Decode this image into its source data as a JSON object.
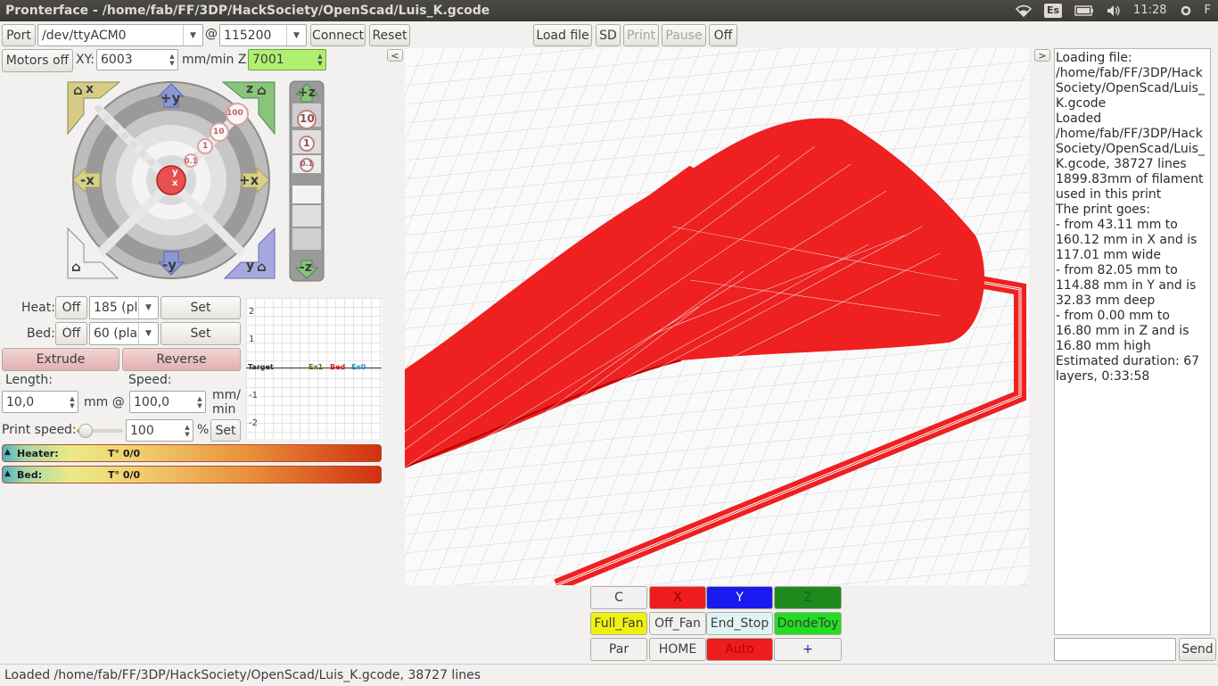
{
  "window": {
    "title": "Pronterface - /home/fab/FF/3DP/HackSociety/OpenScad/Luis_K.gcode"
  },
  "tray": {
    "keyboard": "Es",
    "time": "11:28",
    "user": "F",
    "icons": [
      "wifi-icon",
      "battery-icon",
      "volume-icon"
    ]
  },
  "toolbar": {
    "port_label": "Port",
    "port_value": "/dev/ttyACM0",
    "at": "@",
    "baud_value": "115200",
    "connect_label": "Connect",
    "reset_label": "Reset",
    "load_label": "Load file",
    "sd_label": "SD",
    "print_label": "Print",
    "pause_label": "Pause",
    "off_label": "Off"
  },
  "motors": {
    "motors_off_label": "Motors off",
    "xy_label": "XY:",
    "xy_value": "6003",
    "mmmin_z_label": "mm/min Z:",
    "z_value": "7001"
  },
  "jog": {
    "home_x": "x",
    "plus_y": "+y",
    "home_z": "z",
    "minus_x": "-x",
    "plus_x": "+x",
    "minus_y": "-y",
    "home_y": "y",
    "steps": [
      "100",
      "10",
      "1",
      "0.1"
    ],
    "center_y": "y",
    "center_x": "x",
    "z_plus": "+z",
    "z_minus": "-z",
    "z_steps": [
      "10",
      "1",
      "0.1"
    ]
  },
  "temps": {
    "heat_label": "Heat:",
    "heat_off": "Off",
    "heat_value": "185 (pl",
    "heat_set": "Set",
    "bed_label": "Bed:",
    "bed_off": "Off",
    "bed_value": "60 (pla",
    "bed_set": "Set"
  },
  "graph": {
    "y_ticks": [
      "2",
      "1",
      "-1",
      "-2"
    ],
    "target_label": "Target",
    "legend": [
      "Ex1",
      "Bed",
      "Ex0"
    ],
    "legend_colors": [
      "#7a6a10",
      "#e02020",
      "#2090d0"
    ]
  },
  "extrude": {
    "extrude_label": "Extrude",
    "reverse_label": "Reverse",
    "length_label": "Length:",
    "speed_label": "Speed:",
    "length_value": "10,0",
    "mm_at": "mm @",
    "speed_value": "100,0",
    "mm_min": "mm/\nmin"
  },
  "print_speed": {
    "label": "Print speed:",
    "value": "100",
    "percent": "%",
    "set_label": "Set",
    "slider_fraction": 0.2
  },
  "gauges": {
    "heater_label": "Heater:",
    "heater_temp": "T° 0/0",
    "bed_label": "Bed:",
    "bed_temp": "T° 0/0"
  },
  "viewport": {
    "collapse_left": "<",
    "collapse_right": ">"
  },
  "macros": [
    {
      "label": "C",
      "bg": "#f2f1f0",
      "fg": "#3c3c3c"
    },
    {
      "label": "X",
      "bg": "#ee1c1c",
      "fg": "#8a0000"
    },
    {
      "label": "Y",
      "bg": "#1a1aee",
      "fg": "#ffffff"
    },
    {
      "label": "Z",
      "bg": "#1e8a1e",
      "fg": "#146614"
    },
    {
      "label": "Full_Fan",
      "bg": "#f0f010",
      "fg": "#3c3c3c"
    },
    {
      "label": "Off_Fan",
      "bg": "#f2f1f0",
      "fg": "#3c3c3c"
    },
    {
      "label": "End_Stop",
      "bg": "#e0f4f4",
      "fg": "#3c3c3c"
    },
    {
      "label": "DondeToy",
      "bg": "#22dd22",
      "fg": "#3c3c3c"
    },
    {
      "label": "Par",
      "bg": "#f2f1f0",
      "fg": "#3c3c3c"
    },
    {
      "label": "HOME",
      "bg": "#f2f1f0",
      "fg": "#3c3c3c"
    },
    {
      "label": "Auto",
      "bg": "#ee1c1c",
      "fg": "#b80000"
    },
    {
      "label": "+",
      "bg": "#f2f1f0",
      "fg": "#2222aa"
    }
  ],
  "log": {
    "lines": [
      "Loading file: /home/fab/FF/3DP/HackSociety/OpenScad/Luis_K.gcode",
      "Loaded /home/fab/FF/3DP/HackSociety/OpenScad/Luis_K.gcode, 38727 lines",
      "1899.83mm of filament used in this print",
      "The print goes:",
      "- from 43.11 mm to 160.12 mm in X and is 117.01 mm wide",
      "- from 82.05 mm to 114.88 mm in Y and is 32.83 mm deep",
      "- from 0.00 mm to 16.80 mm in Z and is 16.80 mm high",
      "Estimated duration: 67 layers, 0:33:58"
    ],
    "input_value": "",
    "send_label": "Send"
  },
  "status": {
    "text": "Loaded /home/fab/FF/3DP/HackSociety/OpenScad/Luis_K.gcode, 38727 lines"
  },
  "colors": {
    "model_red": "#ee2020",
    "z_field": "#b0f070"
  }
}
